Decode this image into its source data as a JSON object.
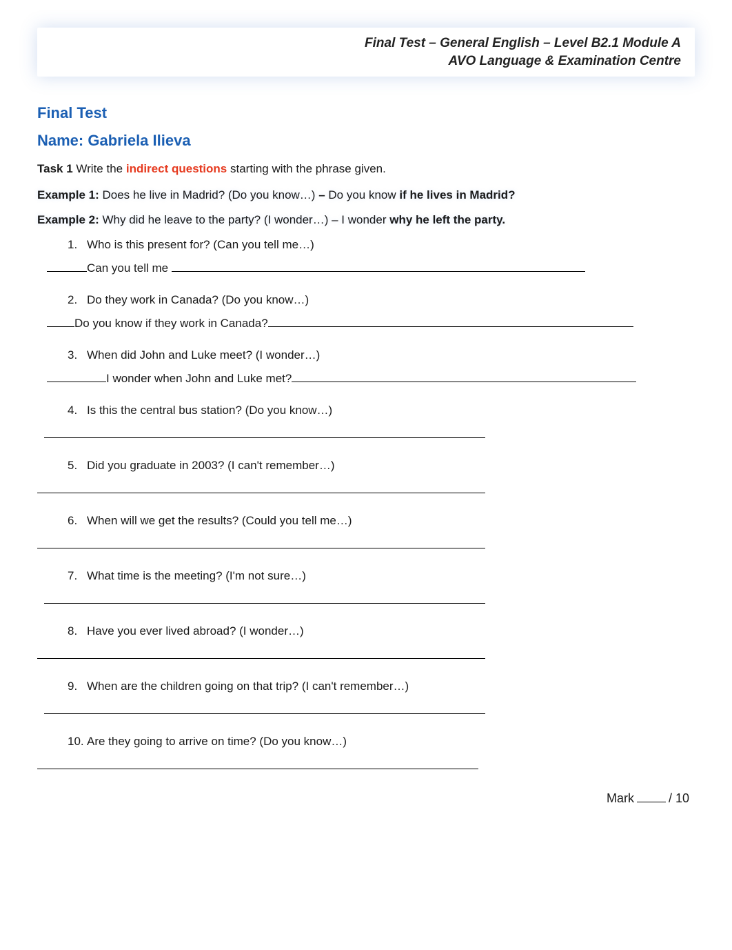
{
  "header": {
    "line1": "Final Test – General English – Level B2.1 Module A",
    "line2": "AVO Language & Examination Centre"
  },
  "title": "Final Test",
  "name_label": "Name:",
  "name_value": "Gabriela Ilieva",
  "task": {
    "label": "Task 1",
    "before": "Write the ",
    "highlight": "indirect questions",
    "after": " starting with the phrase given."
  },
  "examples": [
    {
      "label": "Example 1:",
      "prompt": "Does he live in Madrid? (Do you know…) ",
      "dash": "–",
      "lead": " Do you know ",
      "answer": "if he lives in Madrid?"
    },
    {
      "label": "Example 2:",
      "prompt": "Why did he leave to the party? (I wonder…) – I wonder ",
      "dash": "",
      "lead": "",
      "answer": "why he left the party."
    }
  ],
  "questions": [
    {
      "n": "1.",
      "text": "Who is this present for? (Can you tell me…)",
      "prefix_w": 58,
      "typed": "Can you tell me ",
      "rest_w": 600
    },
    {
      "n": "2.",
      "text": "Do they work in Canada? (Do you know…)",
      "prefix_w": 40,
      "typed": "Do you know if they work in Canada?",
      "rest_w": 530
    },
    {
      "n": "3.",
      "text": "When did John and Luke meet? (I wonder…)",
      "prefix_w": 86,
      "typed": "I wonder when John and Luke  met?",
      "rest_w": 500
    },
    {
      "n": "4.",
      "text": "Is this the central bus station? (Do you know…)",
      "blank": true
    },
    {
      "n": "5.",
      "text": "Did you graduate in 2003? (I can't remember…)",
      "blank": true,
      "left0": true
    },
    {
      "n": "6.",
      "text": "When will we get the results? (Could you tell me…)",
      "blank": true,
      "left0": true
    },
    {
      "n": "7.",
      "text": "What time is the meeting? (I'm not sure…)",
      "blank": true
    },
    {
      "n": "8.",
      "text": "Have you ever lived abroad? (I wonder…)",
      "blank": true,
      "left0": true
    },
    {
      "n": "9.",
      "text": "When are the children going on that trip?  (I can't remember…)",
      "blank": true
    },
    {
      "n": "10.",
      "text": "Are they going to arrive on time? (Do you know…)",
      "blank": true,
      "left0": true,
      "narrow": true
    }
  ],
  "mark": {
    "label": "Mark",
    "total": "/ 10"
  }
}
